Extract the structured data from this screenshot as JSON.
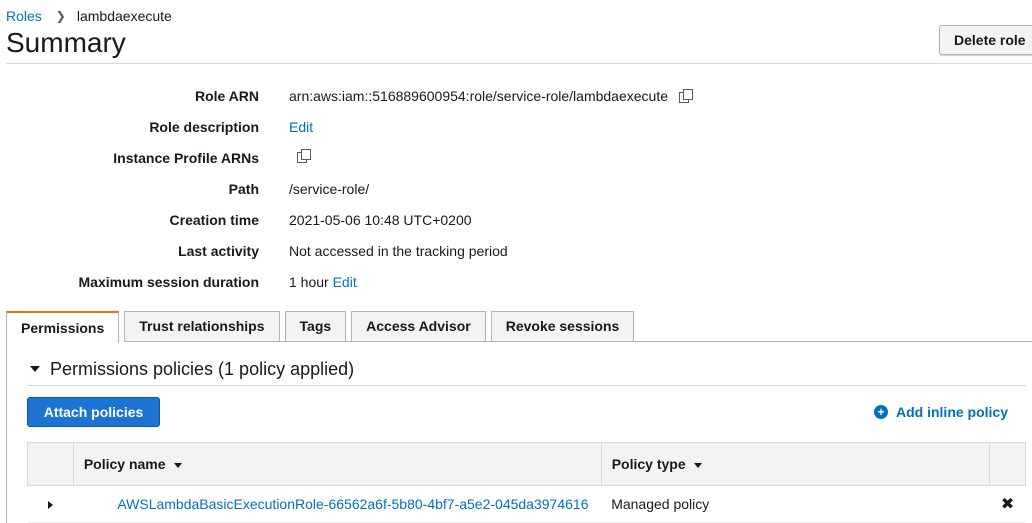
{
  "breadcrumb": {
    "parent": "Roles",
    "current": "lambdaexecute"
  },
  "page_title": "Summary",
  "delete_role_label": "Delete role",
  "summary": {
    "role_arn": {
      "label": "Role ARN",
      "value": "arn:aws:iam::516889600954:role/service-role/lambdaexecute"
    },
    "role_description": {
      "label": "Role description",
      "value": "Edit"
    },
    "instance_profile": {
      "label": "Instance Profile ARNs"
    },
    "path": {
      "label": "Path",
      "value": "/service-role/"
    },
    "creation_time": {
      "label": "Creation time",
      "value": "2021-05-06 10:48 UTC+0200"
    },
    "last_activity": {
      "label": "Last activity",
      "value": "Not accessed in the tracking period"
    },
    "max_session": {
      "label": "Maximum session duration",
      "value": "1 hour",
      "edit": "Edit"
    }
  },
  "tabs": [
    "Permissions",
    "Trust relationships",
    "Tags",
    "Access Advisor",
    "Revoke sessions"
  ],
  "active_tab": "Permissions",
  "permissions": {
    "section_title": "Permissions policies (1 policy applied)",
    "attach_label": "Attach policies",
    "add_inline_label": "Add inline policy",
    "columns": {
      "name": "Policy name",
      "type": "Policy type"
    },
    "rows": [
      {
        "name": "AWSLambdaBasicExecutionRole-66562a6f-5b80-4bf7-a5e2-045da3974616",
        "type": "Managed policy"
      }
    ]
  },
  "colors": {
    "link": "#0073bb",
    "primary_button": "#1b74d2",
    "active_tab_accent": "#ec7211"
  },
  "icons": [
    "chevron-right-icon",
    "copy-icon",
    "caret-down-icon",
    "plus-circle-icon",
    "sort-caret-icon",
    "expand-caret-icon",
    "close-icon"
  ]
}
